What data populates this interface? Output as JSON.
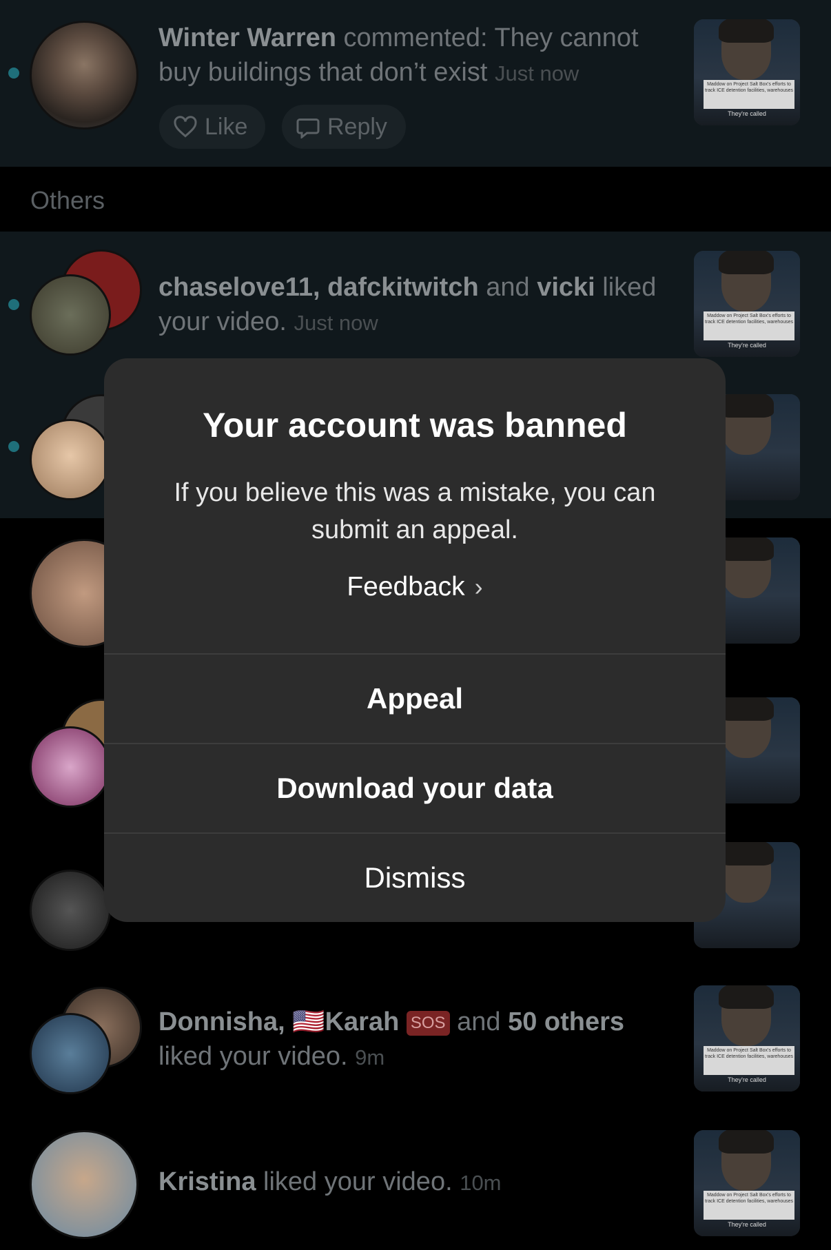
{
  "notifications": [
    {
      "actor": "Winter Warren",
      "text": " commented: They cannot buy buildings that don’t exist",
      "time": "Just now",
      "like": "Like",
      "reply": "Reply"
    },
    {
      "section": "Others"
    },
    {
      "actors_a": "chaselove11, dafckitwitch",
      "mid": " and ",
      "actors_b": "vicki",
      "text": " liked your video.",
      "time": "Just now"
    },
    {
      "a": "Donnisha,",
      "flag": "🇺🇸",
      "b": "Karah",
      "sos": "SOS",
      "mid": " and ",
      "c": "50 others",
      "text": "liked your video.",
      "time": "9m"
    },
    {
      "actor": "Kristina",
      "text": " liked your video.",
      "time": "10m"
    }
  ],
  "thumb_caption": "Maddow on Project Salt Box's efforts to track ICE detention facilities, warehouses",
  "thumb_caption2": "They're called",
  "modal": {
    "title": "Your account was banned",
    "message": "If you believe this was a mistake, you can submit an appeal.",
    "feedback": "Feedback",
    "appeal": "Appeal",
    "download": "Download your data",
    "dismiss": "Dismiss"
  }
}
